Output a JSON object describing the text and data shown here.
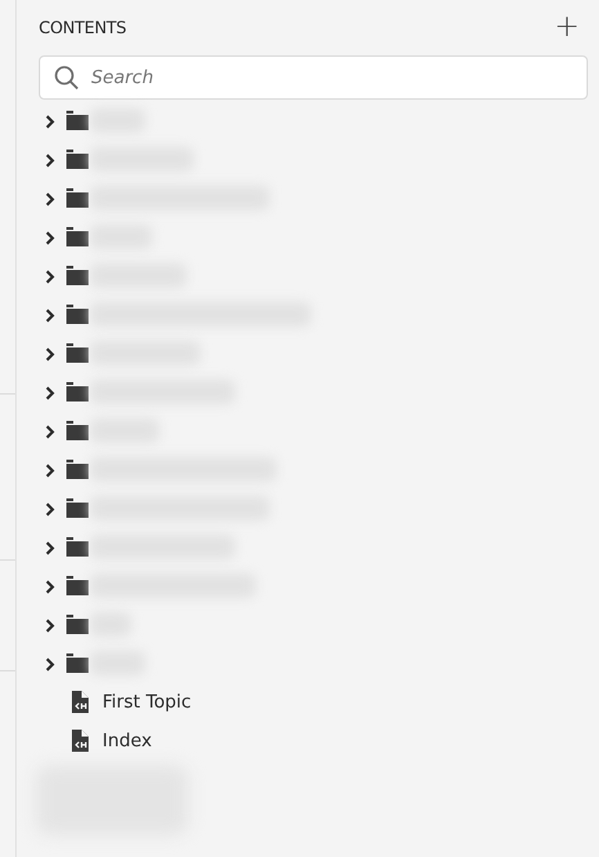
{
  "panel": {
    "title": "CONTENTS",
    "add_button": "+",
    "search": {
      "placeholder": "Search"
    }
  },
  "tree": [
    {
      "kind": "folder",
      "expanded": false
    },
    {
      "kind": "folder",
      "expanded": false
    },
    {
      "kind": "folder",
      "expanded": false
    },
    {
      "kind": "folder",
      "expanded": false
    },
    {
      "kind": "folder",
      "expanded": false
    },
    {
      "kind": "folder",
      "expanded": false
    },
    {
      "kind": "folder",
      "expanded": false
    },
    {
      "kind": "folder",
      "expanded": false
    },
    {
      "kind": "folder",
      "expanded": false
    },
    {
      "kind": "folder",
      "expanded": false
    },
    {
      "kind": "folder",
      "expanded": false
    },
    {
      "kind": "folder",
      "expanded": false
    },
    {
      "kind": "folder",
      "expanded": false
    },
    {
      "kind": "folder",
      "expanded": false
    },
    {
      "kind": "folder",
      "expanded": false
    },
    {
      "kind": "file",
      "label": "First Topic"
    },
    {
      "kind": "file",
      "label": "Index"
    }
  ]
}
